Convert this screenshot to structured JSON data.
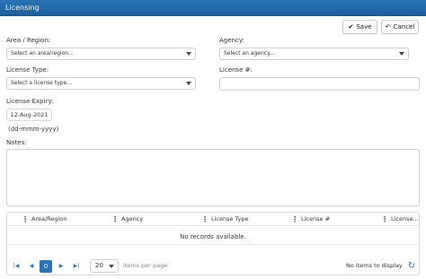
{
  "window": {
    "title": "Licensing"
  },
  "toolbar": {
    "save_label": "Save",
    "cancel_label": "Cancel"
  },
  "form": {
    "area_label": "Area / Region:",
    "area_placeholder": "Select an area/region...",
    "agency_label": "Agency:",
    "agency_placeholder": "Select an agency...",
    "license_type_label": "License Type:",
    "license_type_placeholder": "Select a license type...",
    "license_number_label": "License #:",
    "license_number_value": "",
    "license_expiry_label": "License Expiry:",
    "license_expiry_value": "12-Aug-2021",
    "date_format_hint": "(dd-mmm-yyyy)",
    "notes_label": "Notes:",
    "notes_value": ""
  },
  "grid": {
    "columns": [
      "Area/Region",
      "Agency",
      "License Type",
      "License #",
      "License..."
    ],
    "empty_text": "No records available.",
    "pager": {
      "current_page": "0",
      "page_size": "20",
      "items_per_page_label": "items per page",
      "status_text": "No items to display"
    }
  },
  "icons": {
    "save": "check-icon",
    "cancel": "undo-icon",
    "refresh": "refresh-icon"
  },
  "colors": {
    "titlebar": "#2a74b6",
    "accent": "#2a74b6"
  }
}
